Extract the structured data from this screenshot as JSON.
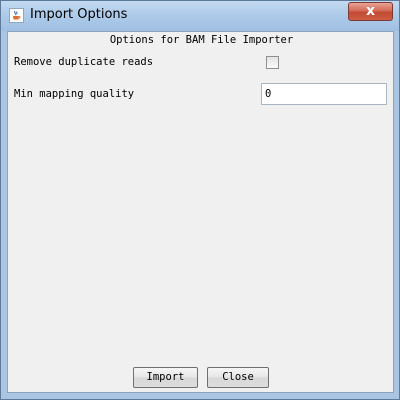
{
  "window": {
    "title": "Import Options",
    "close_glyph": "x",
    "icon": "java-cup-icon"
  },
  "dialog": {
    "heading": "Options for BAM File Importer",
    "options": [
      {
        "label": "Remove duplicate reads",
        "type": "checkbox",
        "checked": false
      },
      {
        "label": "Min mapping quality",
        "type": "text",
        "value": "0"
      }
    ]
  },
  "buttons": {
    "import_label": "Import",
    "close_label": "Close"
  },
  "colors": {
    "titlebar": "#aecbe9",
    "client_bg": "#f0f0f0",
    "close_button": "#c24a33"
  }
}
